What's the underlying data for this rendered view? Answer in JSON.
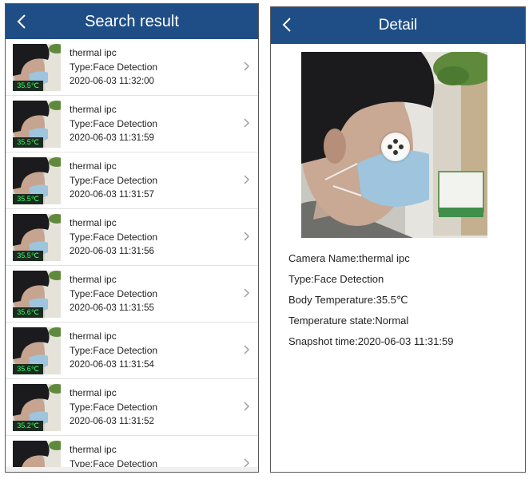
{
  "search_screen": {
    "title": "Search result",
    "items": [
      {
        "name": "thermal ipc",
        "type": "Type:Face Detection",
        "time": "2020-06-03  11:32:00",
        "temp": "35.5℃"
      },
      {
        "name": "thermal ipc",
        "type": "Type:Face Detection",
        "time": "2020-06-03  11:31:59",
        "temp": "35.5℃"
      },
      {
        "name": "thermal ipc",
        "type": "Type:Face Detection",
        "time": "2020-06-03  11:31:57",
        "temp": "35.5℃"
      },
      {
        "name": "thermal ipc",
        "type": "Type:Face Detection",
        "time": "2020-06-03  11:31:56",
        "temp": "35.5℃"
      },
      {
        "name": "thermal ipc",
        "type": "Type:Face Detection",
        "time": "2020-06-03  11:31:55",
        "temp": "35.6℃"
      },
      {
        "name": "thermal ipc",
        "type": "Type:Face Detection",
        "time": "2020-06-03  11:31:54",
        "temp": "35.6℃"
      },
      {
        "name": "thermal ipc",
        "type": "Type:Face Detection",
        "time": "2020-06-03  11:31:52",
        "temp": "35.2℃"
      },
      {
        "name": "thermal ipc",
        "type": "Type:Face Detection",
        "time": "",
        "temp": ""
      }
    ]
  },
  "detail_screen": {
    "title": "Detail",
    "camera_name": "Camera Name:thermal ipc",
    "type": "Type:Face Detection",
    "body_temperature": "Body Temperature:35.5℃",
    "temperature_state": "Temperature state:Normal",
    "snapshot_time": "Snapshot time:2020-06-03  11:31:59"
  },
  "colors": {
    "header": "#1f4e86",
    "badge_text": "#33ff66",
    "badge_bg": "#1c2a1f"
  },
  "icons": {
    "back": "chevron-left-icon",
    "row_arrow": "chevron-right-icon",
    "play": "play-icon"
  }
}
